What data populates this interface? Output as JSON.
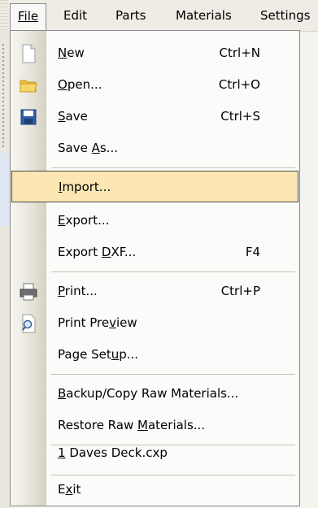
{
  "menubar": {
    "file": "File",
    "edit": "Edit",
    "parts": "Parts",
    "materials": "Materials",
    "settings": "Settings"
  },
  "menu": {
    "items": [
      {
        "label_pre": "",
        "key": "N",
        "label_post": "ew",
        "shortcut": "Ctrl+N",
        "icon": "new-document-icon"
      },
      {
        "label_pre": "",
        "key": "O",
        "label_post": "pen...",
        "shortcut": "Ctrl+O",
        "icon": "open-folder-icon"
      },
      {
        "label_pre": "",
        "key": "S",
        "label_post": "ave",
        "shortcut": "Ctrl+S",
        "icon": "save-disk-icon"
      },
      {
        "label_pre": "Save ",
        "key": "A",
        "label_post": "s...",
        "shortcut": ""
      },
      {
        "label_pre": "",
        "key": "I",
        "label_post": "mport...",
        "shortcut": "",
        "highlighted": true
      },
      {
        "label_pre": "",
        "key": "E",
        "label_post": "xport...",
        "shortcut": ""
      },
      {
        "label_pre": "Export ",
        "key": "D",
        "label_post": "XF...",
        "shortcut": "F4"
      },
      {
        "label_pre": "",
        "key": "P",
        "label_post": "rint...",
        "shortcut": "Ctrl+P",
        "icon": "printer-icon"
      },
      {
        "label_pre": "Print Pre",
        "key": "v",
        "label_post": "iew",
        "shortcut": "",
        "icon": "print-preview-icon"
      },
      {
        "label_pre": "Page Set",
        "key": "u",
        "label_post": "p...",
        "shortcut": ""
      },
      {
        "label_pre": "",
        "key": "B",
        "label_post": "ackup/Copy Raw Materials...",
        "shortcut": ""
      },
      {
        "label_pre": "Restore Raw ",
        "key": "M",
        "label_post": "aterials...",
        "shortcut": ""
      },
      {
        "label_pre": "",
        "key": "1",
        "label_post": " Daves Deck.cxp",
        "shortcut": ""
      },
      {
        "label_pre": "E",
        "key": "x",
        "label_post": "it",
        "shortcut": ""
      }
    ]
  },
  "colors": {
    "highlight": "#fbe6b4",
    "menu_bg": "#fbfbf9",
    "border": "#8a8a8a"
  }
}
